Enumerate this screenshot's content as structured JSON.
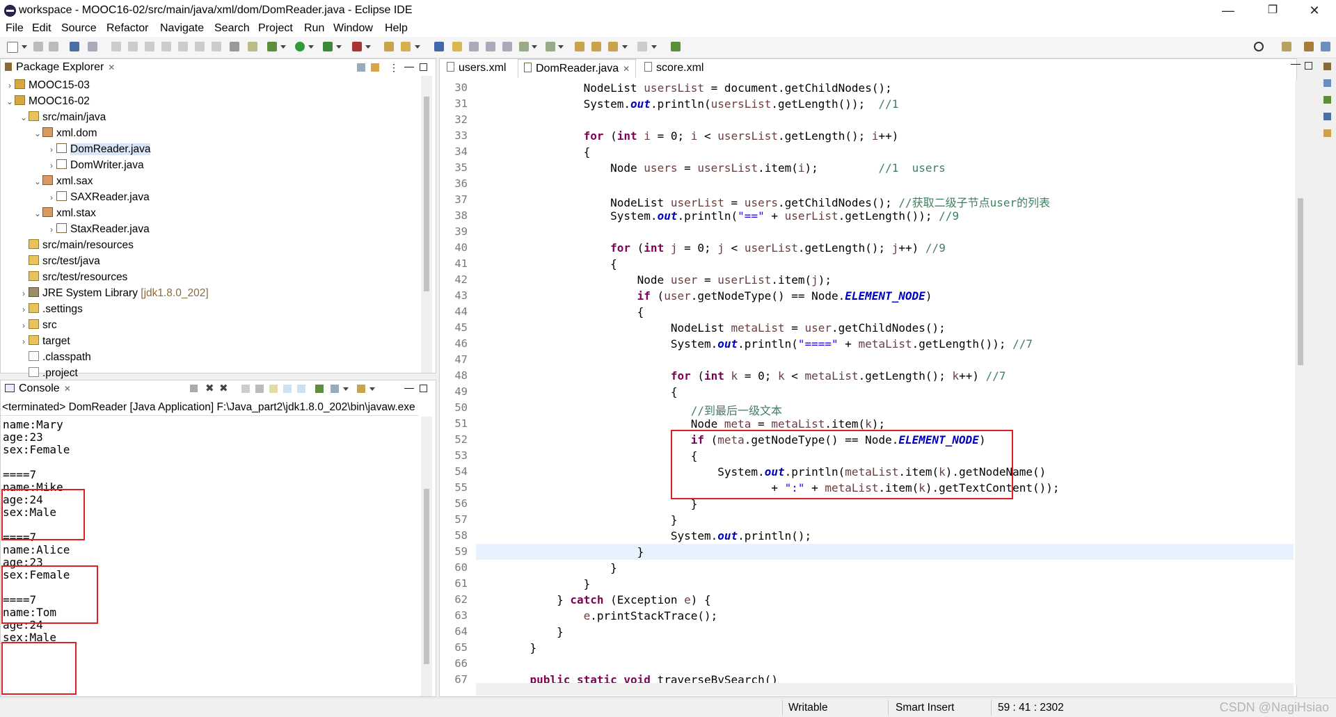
{
  "window": {
    "title": "workspace - MOOC16-02/src/main/java/xml/dom/DomReader.java - Eclipse IDE",
    "controls": {
      "minimize": "—",
      "maximize": "❐",
      "close": "✕"
    }
  },
  "menu": [
    "File",
    "Edit",
    "Source",
    "Refactor",
    "Navigate",
    "Search",
    "Project",
    "Run",
    "Window",
    "Help"
  ],
  "package_explorer": {
    "tab_label": "Package Explorer",
    "tree": [
      {
        "label": "MOOC15-03",
        "twisty": "›",
        "icon": "project-icon"
      },
      {
        "label": "MOOC16-02",
        "twisty": "⌄",
        "icon": "project-icon"
      },
      {
        "label": "src/main/java",
        "twisty": "⌄",
        "icon": "source-folder-icon"
      },
      {
        "label": "xml.dom",
        "twisty": "⌄",
        "icon": "package-icon"
      },
      {
        "label": "DomReader.java",
        "twisty": "›",
        "icon": "java-file-icon",
        "selected": true
      },
      {
        "label": "DomWriter.java",
        "twisty": "›",
        "icon": "java-file-icon"
      },
      {
        "label": "xml.sax",
        "twisty": "⌄",
        "icon": "package-icon"
      },
      {
        "label": "SAXReader.java",
        "twisty": "›",
        "icon": "java-file-icon"
      },
      {
        "label": "xml.stax",
        "twisty": "⌄",
        "icon": "package-icon"
      },
      {
        "label": "StaxReader.java",
        "twisty": "›",
        "icon": "java-file-icon"
      },
      {
        "label": "src/main/resources",
        "twisty": "",
        "icon": "source-folder-icon"
      },
      {
        "label": "src/test/java",
        "twisty": "",
        "icon": "source-folder-icon"
      },
      {
        "label": "src/test/resources",
        "twisty": "",
        "icon": "source-folder-icon"
      },
      {
        "label": "JRE System Library",
        "decoration": "[jdk1.8.0_202]",
        "twisty": "›",
        "icon": "library-icon"
      },
      {
        "label": ".settings",
        "twisty": "›",
        "icon": "folder-icon"
      },
      {
        "label": "src",
        "twisty": "›",
        "icon": "folder-icon"
      },
      {
        "label": "target",
        "twisty": "›",
        "icon": "folder-icon"
      },
      {
        "label": ".classpath",
        "twisty": "",
        "icon": "xml-file-icon"
      },
      {
        "label": ".project",
        "twisty": "",
        "icon": "xml-file-icon"
      }
    ]
  },
  "console": {
    "tab_label": "Console",
    "status": "<terminated> DomReader [Java Application] F:\\Java_part2\\jdk1.8.0_202\\bin\\javaw.exe",
    "lines": [
      "name:Mary",
      "age:23",
      "sex:Female",
      "",
      "====7",
      "name:Mike",
      "age:24",
      "sex:Male",
      "",
      "====7",
      "name:Alice",
      "age:23",
      "sex:Female",
      "",
      "====7",
      "name:Tom",
      "age:24",
      "sex:Male"
    ]
  },
  "editor": {
    "tabs": [
      {
        "label": "users.xml",
        "active": false
      },
      {
        "label": "DomReader.java",
        "active": true
      },
      {
        "label": "score.xml",
        "active": false
      }
    ],
    "line_numbers": [
      "30",
      "31",
      "32",
      "33",
      "34",
      "35",
      "36",
      "37",
      "38",
      "39",
      "40",
      "41",
      "42",
      "43",
      "44",
      "45",
      "46",
      "47",
      "48",
      "49",
      "50",
      "51",
      "52",
      "53",
      "54",
      "55",
      "56",
      "57",
      "58",
      "59",
      "60",
      "61",
      "62",
      "63",
      "64",
      "65",
      "66",
      "67"
    ],
    "current_line": "59",
    "code": [
      [
        [
          "            ",
          ""
        ],
        [
          "NodeList ",
          ""
        ],
        [
          "usersList",
          "var"
        ],
        [
          " = document.getChildNodes();",
          ""
        ]
      ],
      [
        [
          "            System.",
          ""
        ],
        [
          "out",
          "fld"
        ],
        [
          ".println(",
          ""
        ],
        [
          "usersList",
          "var"
        ],
        [
          ".getLength());  ",
          ""
        ],
        [
          "//1",
          "cmt"
        ]
      ],
      [],
      [
        [
          "            ",
          ""
        ],
        [
          "for",
          "kw"
        ],
        [
          " (",
          ""
        ],
        [
          "int",
          "kw"
        ],
        [
          " ",
          ""
        ],
        [
          "i",
          "var"
        ],
        [
          " = 0; ",
          ""
        ],
        [
          "i",
          "var"
        ],
        [
          " < ",
          ""
        ],
        [
          "usersList",
          "var"
        ],
        [
          ".getLength(); ",
          ""
        ],
        [
          "i",
          "var"
        ],
        [
          "++)",
          ""
        ]
      ],
      [
        [
          "            {",
          ""
        ]
      ],
      [
        [
          "                Node ",
          ""
        ],
        [
          "users",
          "var"
        ],
        [
          " = ",
          ""
        ],
        [
          "usersList",
          "var"
        ],
        [
          ".item(",
          ""
        ],
        [
          "i",
          "var"
        ],
        [
          ");         ",
          ""
        ],
        [
          "//1  users",
          "cmt"
        ]
      ],
      [],
      [
        [
          "                NodeList ",
          ""
        ],
        [
          "userList",
          "var"
        ],
        [
          " = ",
          ""
        ],
        [
          "users",
          "var"
        ],
        [
          ".getChildNodes(); ",
          ""
        ],
        [
          "//获取二级子节点user的列表",
          "cmt"
        ]
      ],
      [
        [
          "                System.",
          ""
        ],
        [
          "out",
          "fld"
        ],
        [
          ".println(",
          ""
        ],
        [
          "\"==\"",
          "str"
        ],
        [
          " + ",
          ""
        ],
        [
          "userList",
          "var"
        ],
        [
          ".getLength()); ",
          ""
        ],
        [
          "//9",
          "cmt"
        ]
      ],
      [],
      [
        [
          "                ",
          ""
        ],
        [
          "for",
          "kw"
        ],
        [
          " (",
          ""
        ],
        [
          "int",
          "kw"
        ],
        [
          " ",
          ""
        ],
        [
          "j",
          "var"
        ],
        [
          " = 0; ",
          ""
        ],
        [
          "j",
          "var"
        ],
        [
          " < ",
          ""
        ],
        [
          "userList",
          "var"
        ],
        [
          ".getLength(); ",
          ""
        ],
        [
          "j",
          "var"
        ],
        [
          "++) ",
          ""
        ],
        [
          "//9",
          "cmt"
        ]
      ],
      [
        [
          "                {",
          ""
        ]
      ],
      [
        [
          "                    Node ",
          ""
        ],
        [
          "user",
          "var"
        ],
        [
          " = ",
          ""
        ],
        [
          "userList",
          "var"
        ],
        [
          ".item(",
          ""
        ],
        [
          "j",
          "var"
        ],
        [
          ");",
          ""
        ]
      ],
      [
        [
          "                    ",
          ""
        ],
        [
          "if",
          "kw"
        ],
        [
          " (",
          ""
        ],
        [
          "user",
          "var"
        ],
        [
          ".getNodeType() == Node.",
          ""
        ],
        [
          "ELEMENT_NODE",
          "fld"
        ],
        [
          ")",
          ""
        ]
      ],
      [
        [
          "                    {",
          ""
        ]
      ],
      [
        [
          "                         NodeList ",
          ""
        ],
        [
          "metaList",
          "var"
        ],
        [
          " = ",
          ""
        ],
        [
          "user",
          "var"
        ],
        [
          ".getChildNodes();",
          ""
        ]
      ],
      [
        [
          "                         System.",
          ""
        ],
        [
          "out",
          "fld"
        ],
        [
          ".println(",
          ""
        ],
        [
          "\"====\"",
          "str"
        ],
        [
          " + ",
          ""
        ],
        [
          "metaList",
          "var"
        ],
        [
          ".getLength()); ",
          ""
        ],
        [
          "//7",
          "cmt"
        ]
      ],
      [],
      [
        [
          "                         ",
          ""
        ],
        [
          "for",
          "kw"
        ],
        [
          " (",
          ""
        ],
        [
          "int",
          "kw"
        ],
        [
          " ",
          ""
        ],
        [
          "k",
          "var"
        ],
        [
          " = 0; ",
          ""
        ],
        [
          "k",
          "var"
        ],
        [
          " < ",
          ""
        ],
        [
          "metaList",
          "var"
        ],
        [
          ".getLength(); ",
          ""
        ],
        [
          "k",
          "var"
        ],
        [
          "++) ",
          ""
        ],
        [
          "//7",
          "cmt"
        ]
      ],
      [
        [
          "                         {",
          ""
        ]
      ],
      [
        [
          "                            ",
          ""
        ],
        [
          "//到最后一级文本",
          "cmt"
        ]
      ],
      [
        [
          "                            Node ",
          ""
        ],
        [
          "meta",
          "var"
        ],
        [
          " = ",
          ""
        ],
        [
          "metaList",
          "var"
        ],
        [
          ".item(",
          ""
        ],
        [
          "k",
          "var"
        ],
        [
          ");",
          ""
        ]
      ],
      [
        [
          "                            ",
          ""
        ],
        [
          "if",
          "kw"
        ],
        [
          " (",
          ""
        ],
        [
          "meta",
          "var"
        ],
        [
          ".getNodeType() == Node.",
          ""
        ],
        [
          "ELEMENT_NODE",
          "fld"
        ],
        [
          ")",
          ""
        ]
      ],
      [
        [
          "                            {",
          ""
        ]
      ],
      [
        [
          "                                System.",
          ""
        ],
        [
          "out",
          "fld"
        ],
        [
          ".println(",
          ""
        ],
        [
          "metaList",
          "var"
        ],
        [
          ".item(",
          ""
        ],
        [
          "k",
          "var"
        ],
        [
          ").getNodeName()",
          ""
        ]
      ],
      [
        [
          "                                        + ",
          ""
        ],
        [
          "\":\"",
          "str"
        ],
        [
          " + ",
          ""
        ],
        [
          "metaList",
          "var"
        ],
        [
          ".item(",
          ""
        ],
        [
          "k",
          "var"
        ],
        [
          ").getTextContent());",
          ""
        ]
      ],
      [
        [
          "                            }",
          ""
        ]
      ],
      [
        [
          "                         }",
          ""
        ]
      ],
      [
        [
          "                         System.",
          ""
        ],
        [
          "out",
          "fld"
        ],
        [
          ".println();",
          ""
        ]
      ],
      [
        [
          "                    }",
          ""
        ]
      ],
      [
        [
          "                }",
          ""
        ]
      ],
      [
        [
          "            }",
          ""
        ]
      ],
      [
        [
          "        } ",
          ""
        ],
        [
          "catch",
          "kw"
        ],
        [
          " (Exception ",
          ""
        ],
        [
          "e",
          "var"
        ],
        [
          ") {",
          ""
        ]
      ],
      [
        [
          "            ",
          ""
        ],
        [
          "e",
          "var"
        ],
        [
          ".printStackTrace();",
          ""
        ]
      ],
      [
        [
          "        }",
          ""
        ]
      ],
      [
        [
          "    }",
          ""
        ]
      ],
      [],
      [
        [
          "    ",
          ""
        ],
        [
          "public",
          "kw"
        ],
        [
          " ",
          ""
        ],
        [
          "static",
          "kw"
        ],
        [
          " ",
          ""
        ],
        [
          "void",
          "kw"
        ],
        [
          " traverseBySearch()",
          ""
        ]
      ]
    ]
  },
  "statusbar": {
    "mode": "Writable",
    "insert": "Smart Insert",
    "position": "59 : 41 : 2302"
  },
  "watermark": "CSDN @NagiHsiao",
  "colors": {
    "keyword": "#7f0055",
    "field": "#0000c0",
    "string": "#2a00ff",
    "comment": "#3f7f5f",
    "variable": "#6a3e3e",
    "annotation_box": "#e02020"
  }
}
